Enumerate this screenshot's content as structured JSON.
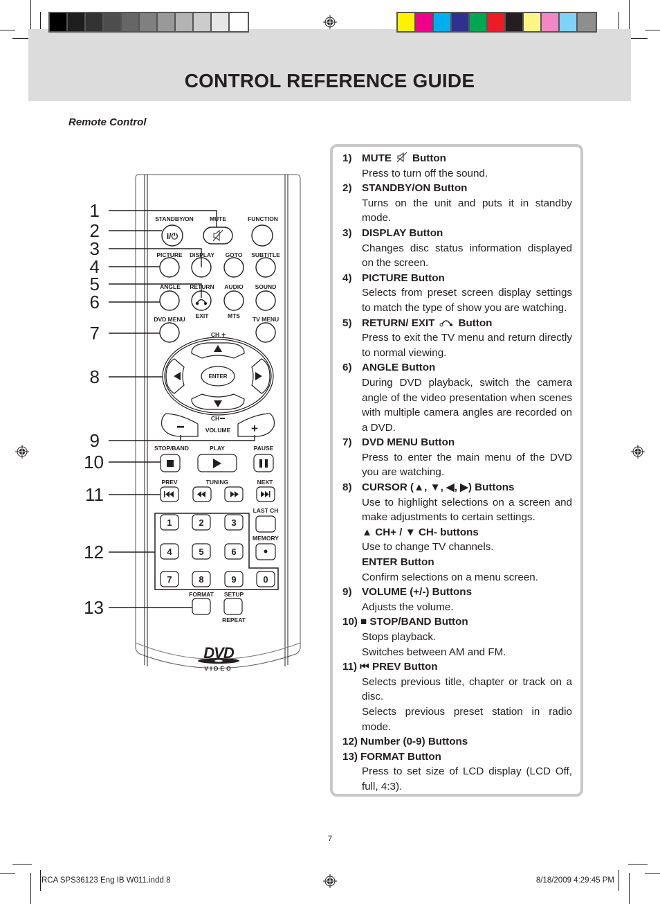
{
  "page": {
    "title": "CONTROL REFERENCE GUIDE",
    "section_label": "Remote Control",
    "page_number": "7",
    "slug_left": "RCA SPS36123 Eng IB W011.indd   8",
    "slug_right": "8/18/2009   4:29:45 PM"
  },
  "color_bars": {
    "grayscale": [
      "#000000",
      "#1e1e1e",
      "#333333",
      "#4d4d4d",
      "#666666",
      "#808080",
      "#999999",
      "#b3b3b3",
      "#cccccc",
      "#e6e6e6",
      "#ffffff"
    ],
    "process": [
      "#fff200",
      "#ec008c",
      "#00aeef",
      "#2e3192",
      "#00a651",
      "#ed1c24",
      "#231f20",
      "#fff685",
      "#f287c4",
      "#7fd3f7",
      "#8e8e8e"
    ]
  },
  "remote": {
    "labels": {
      "standby_on": "STANDBY/ON",
      "mute": "MUTE",
      "function": "FUNCTION",
      "picture": "PICTURE",
      "display": "DISPLAY",
      "goto": "GOTO",
      "subtitle": "SUBTITLE",
      "angle": "ANGLE",
      "return": "RETURN",
      "audio": "AUDIO",
      "sound": "SOUND",
      "exit": "EXIT",
      "mts": "MTS",
      "dvd_menu": "DVD MENU",
      "tv_menu": "TV MENU",
      "ch_plus": "CH",
      "ch_minus": "CH",
      "enter": "ENTER",
      "volume": "VOLUME",
      "stop_band": "STOP/BAND",
      "play": "PLAY",
      "pause": "PAUSE",
      "prev": "PREV",
      "tuning": "TUNING",
      "next": "NEXT",
      "last_ch": "LAST CH",
      "memory": "MEMORY",
      "format": "FORMAT",
      "setup": "SETUP",
      "repeat": "REPEAT",
      "standby_glyph": "I/⏻",
      "logo_dvd": "DVD",
      "logo_video": "VIDEO"
    },
    "digits": [
      "1",
      "2",
      "3",
      "4",
      "5",
      "6",
      "7",
      "8",
      "9",
      "0"
    ],
    "callouts": [
      "1",
      "2",
      "3",
      "4",
      "5",
      "6",
      "7",
      "8",
      "9",
      "10",
      "11",
      "12",
      "13"
    ]
  },
  "guide": [
    {
      "num": "1)",
      "title": "MUTE",
      "icon": "mute-icon",
      "title_after": "Button",
      "desc": [
        "Press to turn off the sound."
      ]
    },
    {
      "num": "2)",
      "title": "STANDBY/ON Button",
      "desc": [
        "Turns on the unit and puts it in standby mode."
      ]
    },
    {
      "num": "3)",
      "title": "DISPLAY Button",
      "desc": [
        "Changes disc status information displayed on the screen."
      ]
    },
    {
      "num": "4)",
      "title": "PICTURE Button",
      "desc": [
        "Selects from preset screen display settings to match the type of show you are watching."
      ]
    },
    {
      "num": "5)",
      "title": "RETURN/ EXIT",
      "icon": "return-icon",
      "title_after": "Button",
      "desc": [
        "Press to exit the TV menu and return directly to normal viewing."
      ]
    },
    {
      "num": "6)",
      "title": "ANGLE Button",
      "desc": [
        "During DVD playback, switch the camera angle of the video presentation when scenes with multiple camera angles are recorded on a DVD."
      ]
    },
    {
      "num": "7)",
      "title": "DVD MENU Button",
      "desc": [
        "Press to enter the main menu of the DVD you are watching."
      ]
    },
    {
      "num": "8)",
      "title": "CURSOR (▲, ▼, ◀, ▶) Buttons",
      "desc": [
        "Use to highlight selections on a screen and make adjustments to certain settings."
      ],
      "sub": [
        {
          "title": "▲ CH+ / ▼ CH- buttons",
          "desc": "Use to change TV channels."
        },
        {
          "title": "ENTER Button",
          "desc": "Confirm selections on a menu screen."
        }
      ]
    },
    {
      "num": "9)",
      "title": "VOLUME (+/-) Buttons",
      "desc": [
        "Adjusts the volume."
      ]
    },
    {
      "num": "10)",
      "title": "■ STOP/BAND Button",
      "desc": [
        "Stops playback.",
        "Switches between AM and FM."
      ]
    },
    {
      "num": "11)",
      "title": "⏮ PREV Button",
      "desc": [
        "Selects previous title, chapter or track on a disc.",
        "Selects previous preset station in radio mode."
      ]
    },
    {
      "num": "12)",
      "title": "Number (0-9) Buttons",
      "desc": []
    },
    {
      "num": "13)",
      "title": "FORMAT Button",
      "desc": [
        "Press to set size of LCD display (LCD Off, full, 4:3)."
      ]
    }
  ]
}
